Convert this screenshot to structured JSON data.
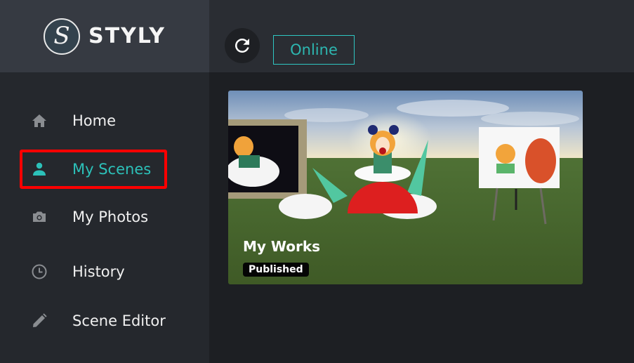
{
  "app": {
    "brand": "STYLY",
    "logo_letter": "S"
  },
  "topbar": {
    "refresh_icon": "refresh-icon",
    "status_label": "Online",
    "accent_color": "#2cc1b9"
  },
  "sidebar": {
    "items": [
      {
        "label": "Home",
        "icon": "home-icon",
        "active": false
      },
      {
        "label": "My Scenes",
        "icon": "person-icon",
        "active": true
      },
      {
        "label": "My Photos",
        "icon": "camera-icon",
        "active": false
      },
      {
        "label": "History",
        "icon": "clock-icon",
        "active": false
      },
      {
        "label": "Scene Editor",
        "icon": "pencil-icon",
        "active": false
      }
    ],
    "highlight_color": "#ff0000"
  },
  "main": {
    "scenes": [
      {
        "title": "My Works",
        "status": "Published"
      }
    ]
  }
}
